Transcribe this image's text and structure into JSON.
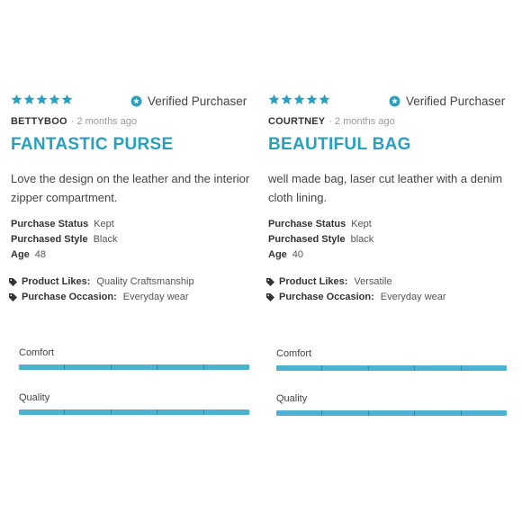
{
  "colors": {
    "accent": "#2aa0bc",
    "bar": "#4bb3cf",
    "text": "#333333"
  },
  "icons": {
    "star": "star-icon",
    "verified": "verified-check-icon",
    "tag": "tag-icon"
  },
  "reviews": [
    {
      "rating": 5,
      "verified": "Verified Purchaser",
      "author": "BETTYBOO",
      "time": "· 2 months ago",
      "title": "FANTASTIC PURSE",
      "body": "Love the design on the leather and the interior zipper compartment.",
      "attributes": [
        {
          "label": "Purchase Status",
          "value": "Kept"
        },
        {
          "label": "Purchased Style",
          "value": "Black"
        },
        {
          "label": "Age",
          "value": "48"
        }
      ],
      "tags": [
        {
          "label": "Product Likes:",
          "value": "Quality Craftsmanship"
        },
        {
          "label": "Purchase Occasion:",
          "value": "Everyday wear"
        }
      ],
      "sliders": [
        {
          "label": "Comfort",
          "level": 1.0
        },
        {
          "label": "Quality",
          "level": 1.0
        }
      ]
    },
    {
      "rating": 5,
      "verified": "Verified Purchaser",
      "author": "COURTNEY",
      "time": "· 2 months ago",
      "title": "BEAUTIFUL BAG",
      "body": "well made bag, laser cut leather with a denim cloth lining.",
      "attributes": [
        {
          "label": "Purchase Status",
          "value": "Kept"
        },
        {
          "label": "Purchased Style",
          "value": "black"
        },
        {
          "label": "Age",
          "value": "40"
        }
      ],
      "tags": [
        {
          "label": "Product Likes:",
          "value": "Versatile"
        },
        {
          "label": "Purchase Occasion:",
          "value": "Everyday wear"
        }
      ],
      "sliders": [
        {
          "label": "Comfort",
          "level": 1.0
        },
        {
          "label": "Quality",
          "level": 1.0
        }
      ]
    }
  ]
}
